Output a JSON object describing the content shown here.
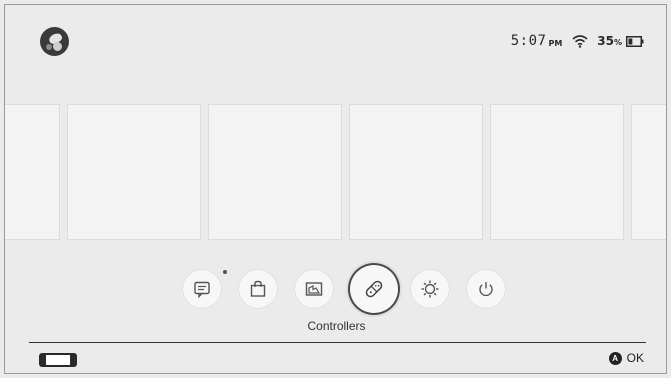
{
  "header": {
    "avatar_icon": "user-avatar-icon",
    "time": "5:07",
    "ampm": "PM",
    "wifi_icon": "wifi-icon",
    "battery_percent": "35",
    "battery_percent_sign": "%",
    "battery_level": 0.35,
    "battery_icon": "battery-icon"
  },
  "game_tiles": [
    {
      "state": "empty"
    },
    {
      "state": "empty"
    },
    {
      "state": "empty"
    },
    {
      "state": "empty"
    },
    {
      "state": "empty"
    },
    {
      "state": "empty"
    }
  ],
  "dock": {
    "items": [
      {
        "name": "news",
        "icon": "news-icon",
        "has_notification": true
      },
      {
        "name": "eshop",
        "icon": "shopping-bag-icon",
        "has_notification": false
      },
      {
        "name": "album",
        "icon": "album-icon",
        "has_notification": false
      },
      {
        "name": "controllers",
        "icon": "controller-icon",
        "selected": true
      },
      {
        "name": "system-settings",
        "icon": "gear-icon",
        "has_notification": false
      },
      {
        "name": "sleep-mode",
        "icon": "power-icon",
        "has_notification": false
      }
    ],
    "selected_label": "Controllers"
  },
  "footer": {
    "console_icon": "handheld-console-icon",
    "button_glyph": "A",
    "ok_label": "OK"
  },
  "colors": {
    "background": "#ebebeb",
    "tile": "#f3f3f3",
    "text": "#2a2a2a",
    "selection_ring": "#4a4a4a"
  }
}
